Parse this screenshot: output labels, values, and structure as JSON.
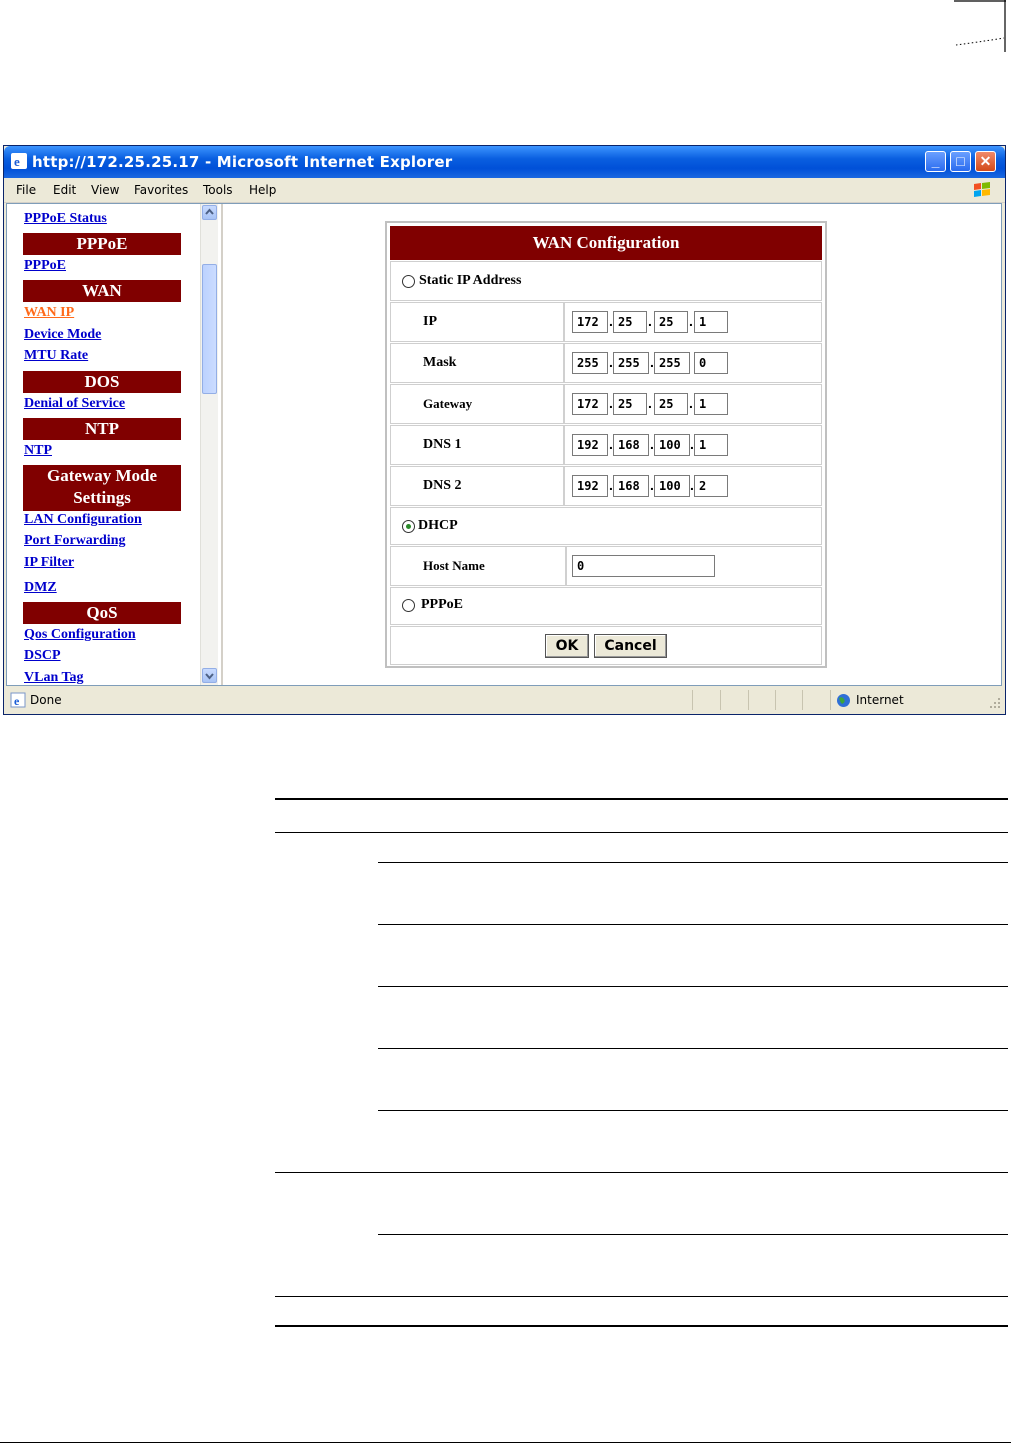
{
  "browser": {
    "title": "http://172.25.25.17 - Microsoft Internet Explorer",
    "menu": [
      "File",
      "Edit",
      "View",
      "Favorites",
      "Tools",
      "Help"
    ],
    "status": "Done",
    "zone": "Internet"
  },
  "nav": {
    "pppoe_status": "PPPoE Status",
    "pppoe_head": "PPPoE",
    "pppoe_link": "PPPoE",
    "wan_head": "WAN",
    "wan_ip": "WAN IP",
    "device_mode": "Device Mode",
    "mtu_rate": "MTU Rate",
    "dos_head": "DOS",
    "denial": "Denial of Service",
    "ntp_head": "NTP",
    "ntp_link": "NTP",
    "gateway_head_1": "Gateway Mode",
    "gateway_head_2": "Settings",
    "lan_config": "LAN Configuration",
    "port_forwarding": "Port Forwarding",
    "ip_filter": "IP Filter",
    "dmz": "DMZ",
    "qos_head": "QoS",
    "qos_config": "Qos Configuration",
    "dscp": "DSCP",
    "vlan_tag": "VLan Tag"
  },
  "wan": {
    "title": "WAN Configuration",
    "static_label": "Static IP Address",
    "ip_label": "IP",
    "mask_label": "Mask",
    "gateway_label": "Gateway",
    "dns1_label": "DNS 1",
    "dns2_label": "DNS 2",
    "ip": [
      "172",
      "25",
      "25",
      "1"
    ],
    "mask": [
      "255",
      "255",
      "255",
      "0"
    ],
    "gateway": [
      "172",
      "25",
      "25",
      "1"
    ],
    "dns1": [
      "192",
      "168",
      "100",
      "1"
    ],
    "dns2": [
      "192",
      "168",
      "100",
      "2"
    ],
    "dhcp_label": "DHCP",
    "host_label": "Host Name",
    "host_value": "0",
    "pppoe_label": "PPPoE",
    "ok": "OK",
    "cancel": "Cancel",
    "selected_mode": "DHCP"
  },
  "colors": {
    "nav_header": "#800000",
    "link": "#0000cc",
    "visited_link": "#ff6a1a",
    "titlebar": "#0a5fe0"
  }
}
